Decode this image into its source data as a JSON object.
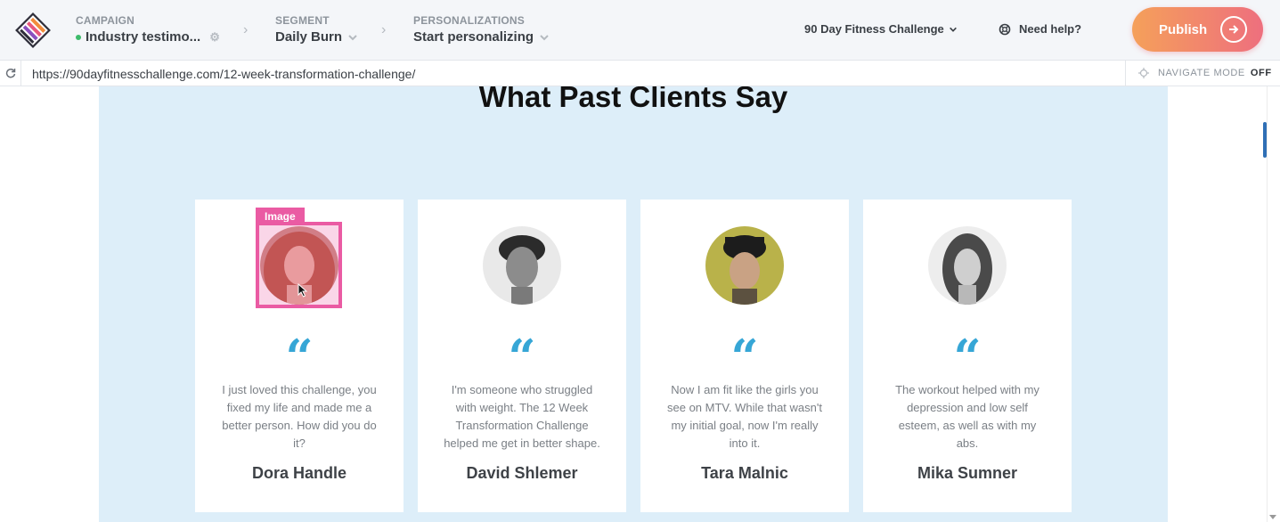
{
  "header": {
    "campaign": {
      "label": "CAMPAIGN",
      "value": "Industry testimo..."
    },
    "segment": {
      "label": "SEGMENT",
      "value": "Daily Burn"
    },
    "personalizations": {
      "label": "PERSONALIZATIONS",
      "value": "Start personalizing"
    },
    "campaign_selector": "90 Day Fitness Challenge",
    "help": "Need help?",
    "publish": "Publish"
  },
  "urlbar": {
    "url": "https://90dayfitnesschallenge.com/12-week-transformation-challenge/",
    "nav_mode_label": "NAVIGATE MODE",
    "nav_mode_state": "OFF"
  },
  "page": {
    "title": "What Past Clients Say",
    "selection_tag": "Image",
    "quote_glyph": "“",
    "testimonials": [
      {
        "quote": "I just loved this challenge, you fixed my life and made me a better person. How did you do it?",
        "name": "Dora Handle"
      },
      {
        "quote": "I'm someone who struggled with weight. The 12 Week Transformation Challenge helped me get in better shape.",
        "name": "David Shlemer"
      },
      {
        "quote": "Now I am fit like the girls you see on MTV. While that wasn't my initial goal, now I'm really into it.",
        "name": "Tara Malnic"
      },
      {
        "quote": "The workout helped with my depression and low self esteem, as well as with my abs.",
        "name": "Mika Sumner"
      }
    ]
  },
  "colors": {
    "accent_blue": "#36a6d6",
    "selection_pink": "#ea5ba3",
    "publish_gradient_start": "#f5a05a",
    "publish_gradient_end": "#ee6f7e",
    "section_bg": "#ddeef9",
    "status_green": "#3dbb6b"
  },
  "icons": {
    "logo": "stacked-layers-logo-icon",
    "refresh": "refresh-icon",
    "help": "lifebuoy-icon",
    "navigate": "crosshair-icon",
    "publish_arrow": "arrow-right-circle-icon"
  }
}
